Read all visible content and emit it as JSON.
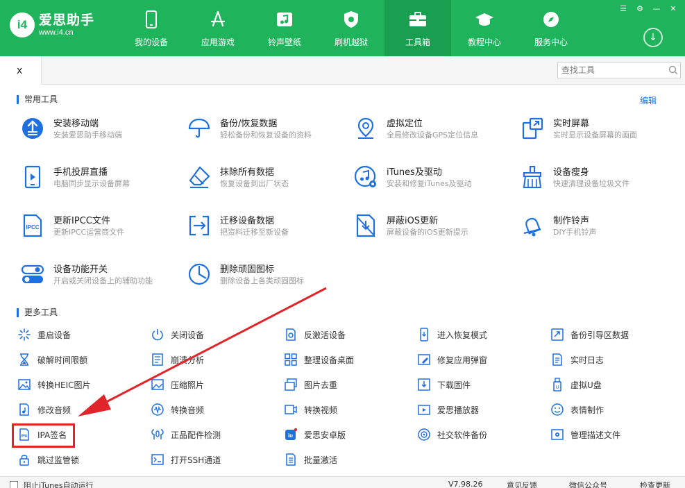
{
  "app": {
    "name": "爱思助手",
    "url": "www.i4.cn",
    "logo_mark": "i4"
  },
  "colors": {
    "brand_green": "#1fb35c",
    "active_green": "#18a050",
    "accent_blue": "#1e6fe0",
    "highlight_red": "#e0252a"
  },
  "nav": [
    {
      "label": "我的设备",
      "icon": "phone-icon",
      "active": false
    },
    {
      "label": "应用游戏",
      "icon": "app-store-icon",
      "active": false
    },
    {
      "label": "铃声壁纸",
      "icon": "music-icon",
      "active": false
    },
    {
      "label": "刷机越狱",
      "icon": "shield-icon",
      "active": false
    },
    {
      "label": "工具箱",
      "icon": "toolbox-icon",
      "active": true
    },
    {
      "label": "教程中心",
      "icon": "graduation-cap-icon",
      "active": false
    },
    {
      "label": "服务中心",
      "icon": "compass-icon",
      "active": false
    }
  ],
  "tabbar": {
    "tab_label": "x",
    "search_placeholder": "查找工具"
  },
  "sections": {
    "common_title": "常用工具",
    "edit_label": "编辑",
    "more_title": "更多工具"
  },
  "common_tools": [
    {
      "title": "安装移动端",
      "desc": "安装爱思助手移动端",
      "icon": "install-mobile-icon"
    },
    {
      "title": "备份/恢复数据",
      "desc": "轻松备份和恢复设备的资料",
      "icon": "umbrella-icon"
    },
    {
      "title": "虚拟定位",
      "desc": "全局修改设备GPS定位信息",
      "icon": "location-pin-icon"
    },
    {
      "title": "实时屏幕",
      "desc": "实时显示设备屏幕的画面",
      "icon": "live-screen-icon"
    },
    {
      "title": "手机投屏直播",
      "desc": "电脑同步显示设备屏幕",
      "icon": "screen-cast-icon"
    },
    {
      "title": "抹除所有数据",
      "desc": "恢复设备到出厂状态",
      "icon": "eraser-icon"
    },
    {
      "title": "iTunes及驱动",
      "desc": "安装和修复iTunes及驱动",
      "icon": "itunes-icon"
    },
    {
      "title": "设备瘦身",
      "desc": "快速清理设备垃圾文件",
      "icon": "broom-icon"
    },
    {
      "title": "更新IPCC文件",
      "desc": "更新IPCC运营商文件",
      "icon": "ipcc-file-icon"
    },
    {
      "title": "迁移设备数据",
      "desc": "把资料迁移至新设备",
      "icon": "migrate-icon"
    },
    {
      "title": "屏蔽iOS更新",
      "desc": "屏蔽设备的iOS更新提示",
      "icon": "block-update-icon"
    },
    {
      "title": "制作铃声",
      "desc": "DIY手机铃声",
      "icon": "bell-icon"
    },
    {
      "title": "设备功能开关",
      "desc": "开启或关闭设备上的辅助功能",
      "icon": "toggle-icon"
    },
    {
      "title": "删除顽固图标",
      "desc": "删除设备上各类顽固图标",
      "icon": "pie-clock-icon"
    }
  ],
  "more_tools": [
    {
      "label": "重启设备",
      "icon": "restart-icon"
    },
    {
      "label": "关闭设备",
      "icon": "power-icon"
    },
    {
      "label": "反激活设备",
      "icon": "deactivate-icon"
    },
    {
      "label": "进入恢复模式",
      "icon": "recovery-mode-icon"
    },
    {
      "label": "备份引导区数据",
      "icon": "backup-boot-icon"
    },
    {
      "label": "破解时间限额",
      "icon": "hourglass-icon"
    },
    {
      "label": "崩溃分析",
      "icon": "crash-analysis-icon"
    },
    {
      "label": "整理设备桌面",
      "icon": "grid-icon"
    },
    {
      "label": "修复应用弹窗",
      "icon": "repair-popup-icon"
    },
    {
      "label": "实时日志",
      "icon": "log-icon"
    },
    {
      "label": "转换HEIC图片",
      "icon": "heic-image-icon"
    },
    {
      "label": "压缩照片",
      "icon": "compress-photo-icon"
    },
    {
      "label": "图片去重",
      "icon": "dedupe-image-icon"
    },
    {
      "label": "下载固件",
      "icon": "download-firmware-icon"
    },
    {
      "label": "虚拟U盘",
      "icon": "usb-drive-icon"
    },
    {
      "label": "修改音频",
      "icon": "audio-edit-icon"
    },
    {
      "label": "转换音频",
      "icon": "audio-convert-icon"
    },
    {
      "label": "转换视频",
      "icon": "video-convert-icon"
    },
    {
      "label": "爱思播放器",
      "icon": "player-icon"
    },
    {
      "label": "表情制作",
      "icon": "emoji-icon"
    },
    {
      "label": "IPA签名",
      "icon": "ipa-icon"
    },
    {
      "label": "正品配件检测",
      "icon": "earphone-icon"
    },
    {
      "label": "爱思安卓版",
      "icon": "i4-android-icon"
    },
    {
      "label": "社交软件备份",
      "icon": "social-backup-icon"
    },
    {
      "label": "管理描述文件",
      "icon": "profile-icon"
    },
    {
      "label": "跳过监管锁",
      "icon": "lock-icon"
    },
    {
      "label": "打开SSH通道",
      "icon": "terminal-icon"
    },
    {
      "label": "批量激活",
      "icon": "batch-activate-icon"
    }
  ],
  "status": {
    "checkbox_label": "阻止iTunes自动运行",
    "version": "V7.98.26",
    "feedback": "意见反馈",
    "wechat": "微信公众号",
    "update": "检查更新"
  }
}
